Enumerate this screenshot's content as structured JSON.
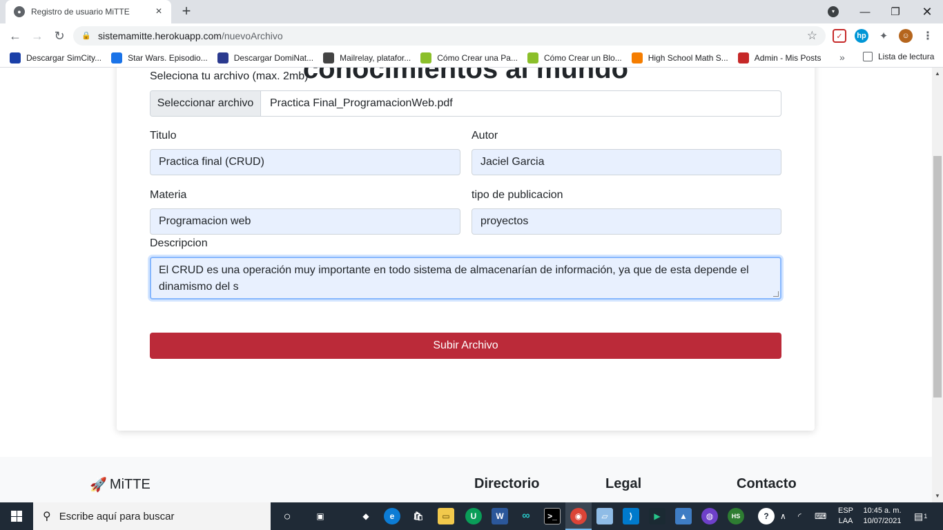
{
  "browser": {
    "tab_title": "Registro de usuario MiTTE",
    "url_host": "sistemamitte.herokuapp.com",
    "url_path": "/nuevoArchivo",
    "bookmarks": [
      {
        "label": "Descargar SimCity...",
        "icon": "simcity-s-icon",
        "color": "#1a3fa8"
      },
      {
        "label": "Star Wars. Episodio...",
        "icon": "folder-icon",
        "color": "#1a73e8"
      },
      {
        "label": "Descargar DomiNat...",
        "icon": "s-logo-icon",
        "color": "#2b3a8f"
      },
      {
        "label": "Mailrelay, platafor...",
        "icon": "mailrelay-icon",
        "color": "#444444"
      },
      {
        "label": "Cómo Crear una Pa...",
        "icon": "si-icon",
        "color": "#8bbf2a"
      },
      {
        "label": "Cómo Crear un Blo...",
        "icon": "si-icon",
        "color": "#8bbf2a"
      },
      {
        "label": "High School Math S...",
        "icon": "blogger-icon",
        "color": "#f57d00"
      },
      {
        "label": "Admin - Mis Posts",
        "icon": "admin-icon",
        "color": "#c62828"
      }
    ],
    "reading_list": "Lista de lectura"
  },
  "form": {
    "heading": "conocimientos al mundo",
    "file_label": "Seleciona tu archivo (max. 2mb)",
    "file_button": "Seleccionar archivo",
    "file_name": "Practica Final_ProgramacionWeb.pdf",
    "titulo_label": "Titulo",
    "titulo_value": "Practica final (CRUD)",
    "autor_label": "Autor",
    "autor_value": "Jaciel Garcia",
    "materia_label": "Materia",
    "materia_value": "Programacion web",
    "tipo_label": "tipo de publicacion",
    "tipo_value": "proyectos",
    "descripcion_label": "Descripcion",
    "descripcion_value": "El CRUD es una operación muy importante en todo sistema de almacenarían de información, ya que de esta depende el dinamismo del s",
    "submit_label": "Subir Archivo",
    "submit_color": "#bb2a39"
  },
  "footer": {
    "brand": "MiTTE",
    "col1": "Directorio",
    "col2": "Legal",
    "col3": "Contacto"
  },
  "taskbar": {
    "search_placeholder": "Escribe aquí para buscar",
    "lang_top": "ESP",
    "lang_bottom": "LAA",
    "time": "10:45 a. m.",
    "date": "10/07/2021",
    "notification_count": "1"
  }
}
